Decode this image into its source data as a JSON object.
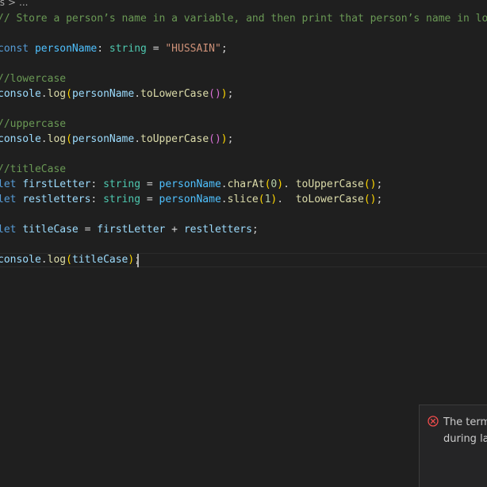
{
  "breadcrumb": {
    "segment": "ts",
    "separator": ">",
    "more": "..."
  },
  "code": {
    "line1": {
      "comment": "// Store a person’s name in a variable, and then print that person’s name in lowe"
    },
    "line3": {
      "kw": "const",
      "var": "personName",
      "colon": ":",
      "type": "string",
      "eq": "=",
      "str": "\"HUSSAIN\"",
      "semi": ";"
    },
    "line5": {
      "comment": "//lowercase"
    },
    "line6": {
      "obj": "console",
      "dot": ".",
      "fn": "log",
      "arg": "personName",
      "method": "toLowerCase"
    },
    "line8": {
      "comment": "//uppercase"
    },
    "line9": {
      "obj": "console",
      "dot": ".",
      "fn": "log",
      "arg": "personName",
      "method": "toUpperCase"
    },
    "line11": {
      "comment": "//titleCase"
    },
    "line12": {
      "kw": "let",
      "var": "firstLetter",
      "type": "string",
      "obj": "personName",
      "fn1": "charAt",
      "num": "0",
      "fn2": "toUpperCase"
    },
    "line13": {
      "kw": "let",
      "var": "restletters",
      "type": "string",
      "obj": "personName",
      "fn1": "slice",
      "num": "1",
      "fn2": "toLowerCase"
    },
    "line15": {
      "kw": "let",
      "var": "titleCase",
      "a": "firstLetter",
      "plus": "+",
      "b": "restletters"
    },
    "line17": {
      "obj": "console",
      "fn": "log",
      "arg": "titleCase"
    }
  },
  "notification": {
    "line1": "The termi",
    "line2": "during lau",
    "icon": "error-circle-icon",
    "icon_color": "#f14c4c"
  }
}
